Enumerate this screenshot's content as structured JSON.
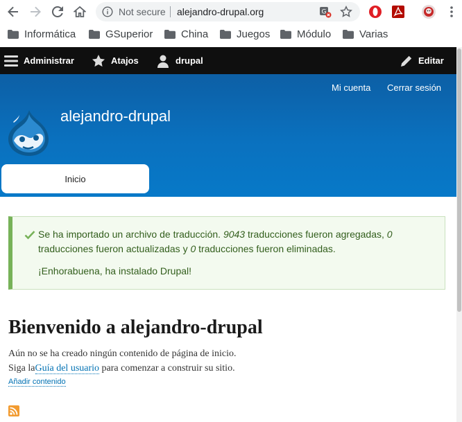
{
  "browser": {
    "security_label": "Not secure",
    "url": "alejandro-drupal.org",
    "bookmarks": [
      "Informática",
      "GSuperior",
      "China",
      "Juegos",
      "Módulo",
      "Varias"
    ]
  },
  "toolbar": {
    "manage": "Administrar",
    "shortcuts": "Atajos",
    "user": "drupal",
    "edit": "Editar"
  },
  "header": {
    "my_account": "Mi cuenta",
    "logout": "Cerrar sesión",
    "site_name": "alejandro-drupal",
    "tab_home": "Inicio"
  },
  "message": {
    "part1": "Se ha importado un archivo de traducción. ",
    "added_count": "9043",
    "part2": " traducciones fueron agregadas, ",
    "updated_count": "0",
    "part3": "traducciones fueron actualizadas y ",
    "deleted_count": "0",
    "part4": " traducciones fueron eliminadas.",
    "congrats": "¡Enhorabuena, ha instalado Drupal!"
  },
  "main": {
    "title": "Bienvenido a alejandro-drupal",
    "no_content": "Aún no se ha creado ningún contenido de página de inicio.",
    "follow_prefix": "Siga la",
    "guide_link": "Guía del usuario",
    "follow_suffix": " para comenzar a construir su sitio.",
    "add_content": "Añadir contenido"
  },
  "colors": {
    "header_blue": "#0779c8",
    "toolbar_bg": "#0f0f0f",
    "message_green": "#325e1c",
    "link_blue": "#0071b3"
  }
}
